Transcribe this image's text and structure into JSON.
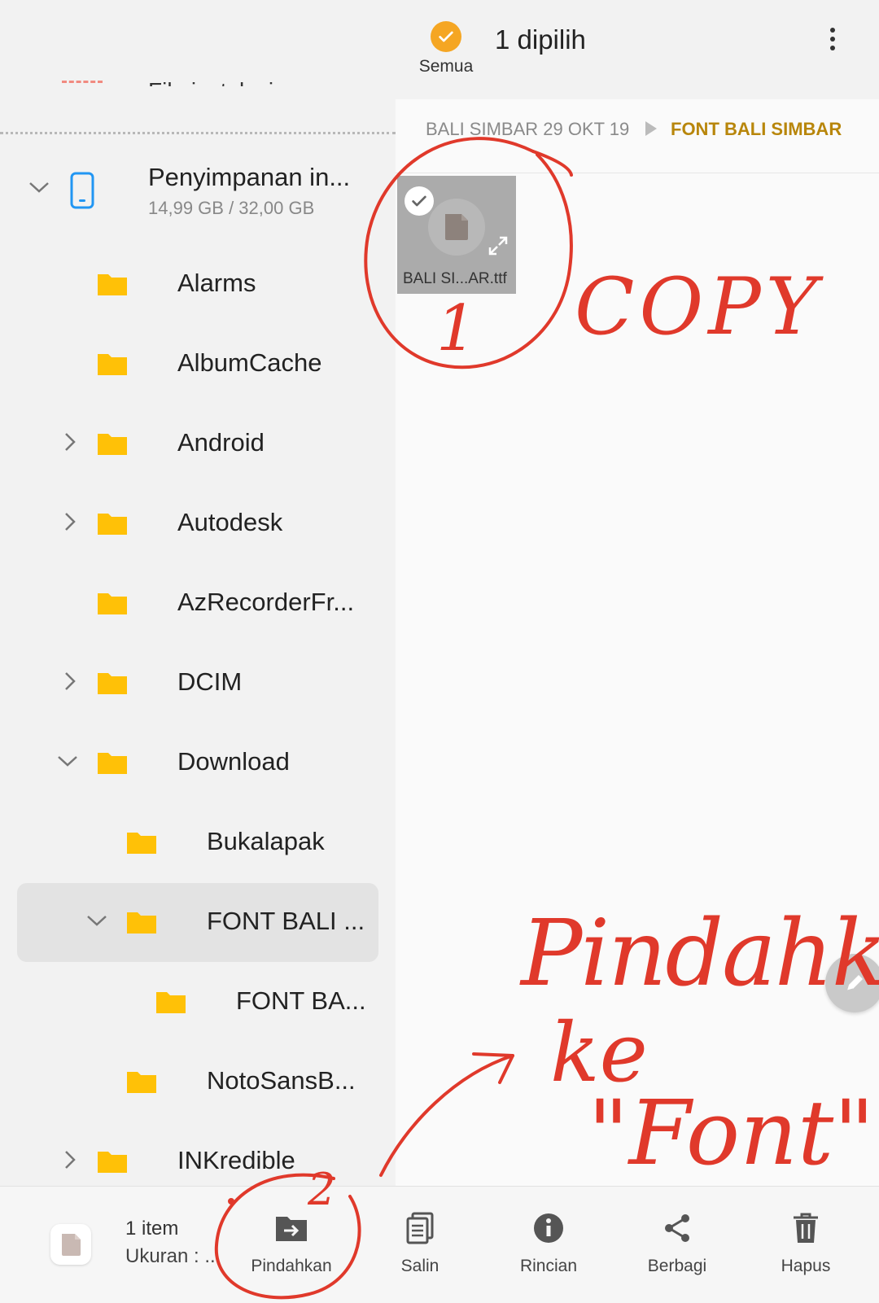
{
  "topbar": {
    "select_all_label": "Semua",
    "title": "1 dipilih",
    "cutoff_text": "File instalasi"
  },
  "storage": {
    "name": "Penyimpanan in...",
    "size": "14,99 GB / 32,00 GB"
  },
  "tree": [
    {
      "label": "Alarms"
    },
    {
      "label": "AlbumCache"
    },
    {
      "label": "Android"
    },
    {
      "label": "Autodesk"
    },
    {
      "label": "AzRecorderFr..."
    },
    {
      "label": "DCIM"
    },
    {
      "label": "Download"
    },
    {
      "label": "Bukalapak"
    },
    {
      "label": "FONT BALI ..."
    },
    {
      "label": "FONT BA..."
    },
    {
      "label": "NotoSansB..."
    },
    {
      "label": "INKredible"
    }
  ],
  "breadcrumb": {
    "parent": "BALI SIMBAR 29 OKT 19",
    "current": "FONT BALI SIMBAR"
  },
  "file": {
    "name": "BALI SI...AR.ttf"
  },
  "bottombar": {
    "count": "1 item",
    "size": "Ukuran : ...",
    "actions": [
      {
        "label": "Pindahkan",
        "icon": "move-folder-icon"
      },
      {
        "label": "Salin",
        "icon": "copy-icon"
      },
      {
        "label": "Rincian",
        "icon": "info-icon"
      },
      {
        "label": "Berbagi",
        "icon": "share-icon"
      },
      {
        "label": "Hapus",
        "icon": "trash-icon"
      }
    ]
  },
  "annotations": {
    "step1": "1",
    "copy": "COPY",
    "step2": "2",
    "move": "Pindahkan",
    "to": "ke",
    "target": "\"Font\""
  },
  "colors": {
    "accent": "#f5a623",
    "folder": "#ffc107",
    "breadcrumb_current": "#b8860b",
    "annotation_red": "#e0392b",
    "phone_icon": "#2196f3"
  }
}
